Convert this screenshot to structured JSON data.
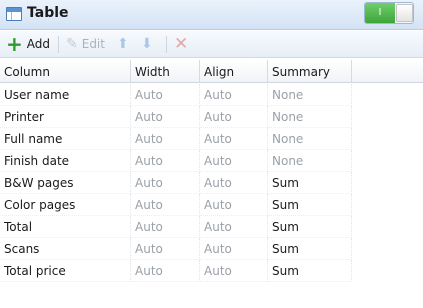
{
  "window": {
    "title": "Table",
    "toggle_label": "I"
  },
  "toolbar": {
    "add_label": "Add",
    "edit_label": "Edit"
  },
  "columns": [
    "Column",
    "Width",
    "Align",
    "Summary"
  ],
  "rows": [
    {
      "column": "User name",
      "width": "Auto",
      "align": "Auto",
      "summary": "None"
    },
    {
      "column": "Printer",
      "width": "Auto",
      "align": "Auto",
      "summary": "None"
    },
    {
      "column": "Full name",
      "width": "Auto",
      "align": "Auto",
      "summary": "None"
    },
    {
      "column": "Finish date",
      "width": "Auto",
      "align": "Auto",
      "summary": "None"
    },
    {
      "column": "B&W pages",
      "width": "Auto",
      "align": "Auto",
      "summary": "Sum"
    },
    {
      "column": "Color pages",
      "width": "Auto",
      "align": "Auto",
      "summary": "Sum"
    },
    {
      "column": "Total",
      "width": "Auto",
      "align": "Auto",
      "summary": "Sum"
    },
    {
      "column": "Scans",
      "width": "Auto",
      "align": "Auto",
      "summary": "Sum"
    },
    {
      "column": "Total price",
      "width": "Auto",
      "align": "Auto",
      "summary": "Sum"
    }
  ],
  "icons": {
    "window": "table-icon",
    "add": "plus-icon",
    "edit": "pencil-icon",
    "move_up": "arrow-up-icon",
    "move_down": "arrow-down-icon",
    "delete": "delete-x-icon"
  },
  "colors": {
    "add_icon": "#2e9b2e",
    "toggle_on": "#4cb447",
    "titlebar": "#d3e3f5"
  }
}
